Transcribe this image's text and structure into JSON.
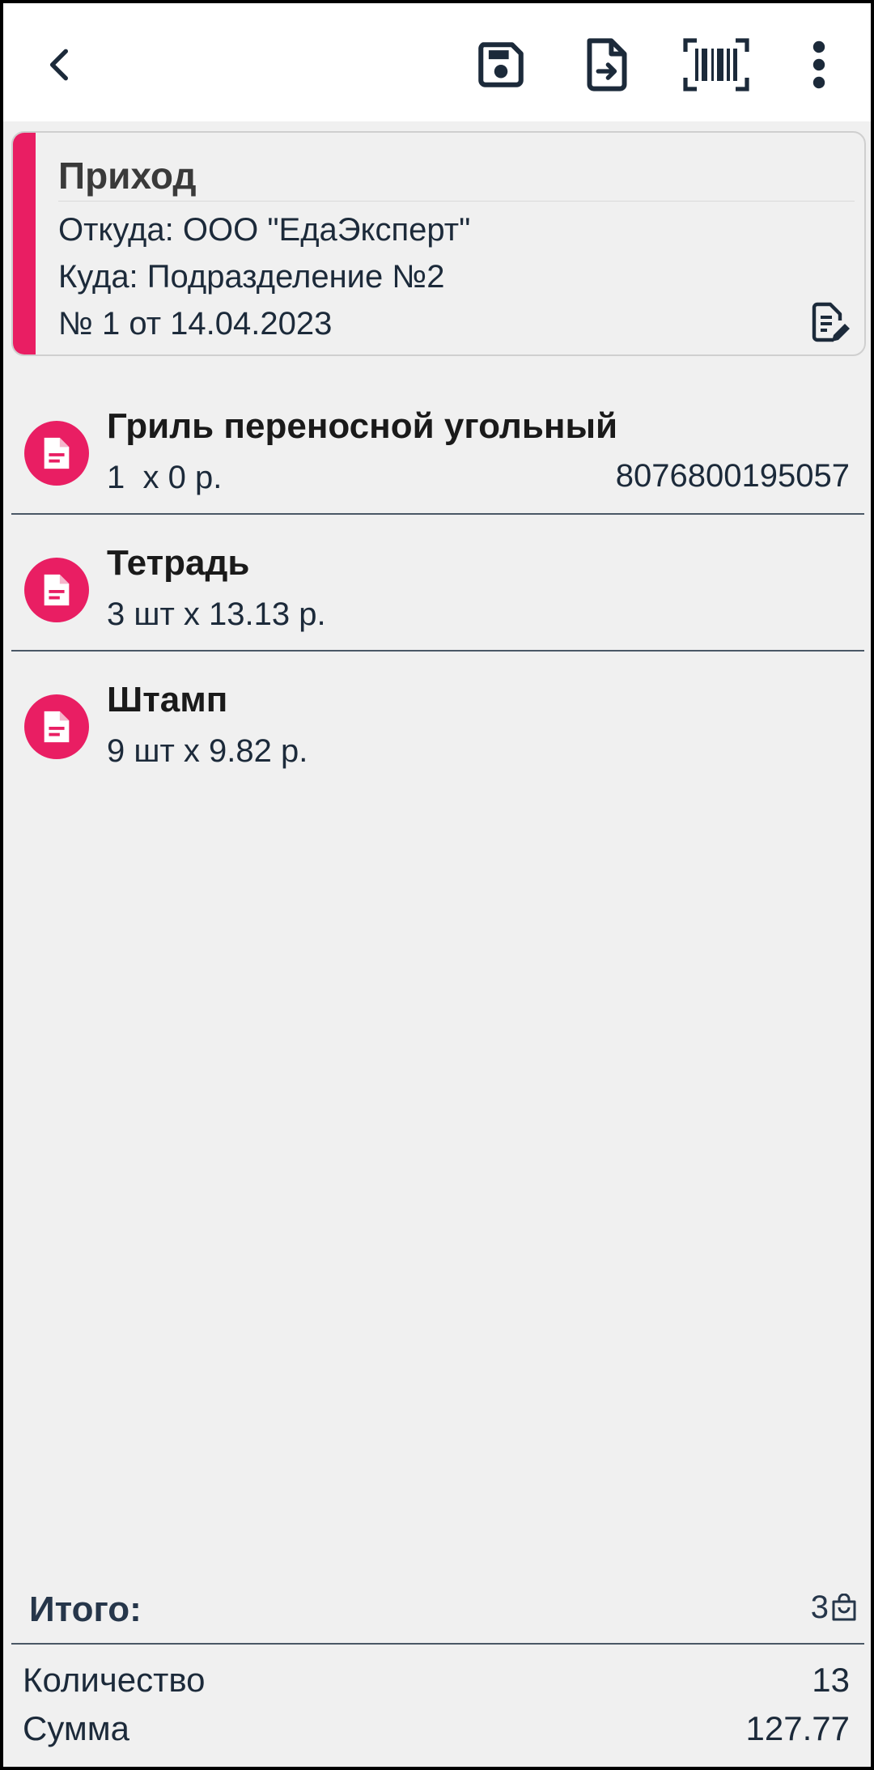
{
  "toolbar": {
    "icons": [
      "back-chevron-icon",
      "save-disk-icon",
      "export-file-icon",
      "barcode-scan-icon",
      "more-vert-icon"
    ]
  },
  "document": {
    "title": "Приход",
    "from": "Откуда: ООО \"ЕдаЭксперт\"",
    "to": "Куда: Подразделение №2",
    "number": "№ 1 от 14.04.2023",
    "accent_color": "#e91e63"
  },
  "items": [
    {
      "name": "Гриль переносной угольный",
      "qty": "1  х 0 р.",
      "barcode": "8076800195057"
    },
    {
      "name": "Тетрадь",
      "qty": "3 шт х 13.13 р.",
      "barcode": ""
    },
    {
      "name": "Штамп",
      "qty": "9 шт х 9.82 р.",
      "barcode": ""
    }
  ],
  "totals": {
    "title": "Итого:",
    "positions": "3",
    "quantity_label": "Количество",
    "quantity_value": "13",
    "sum_label": "Сумма",
    "sum_value": "127.77"
  }
}
